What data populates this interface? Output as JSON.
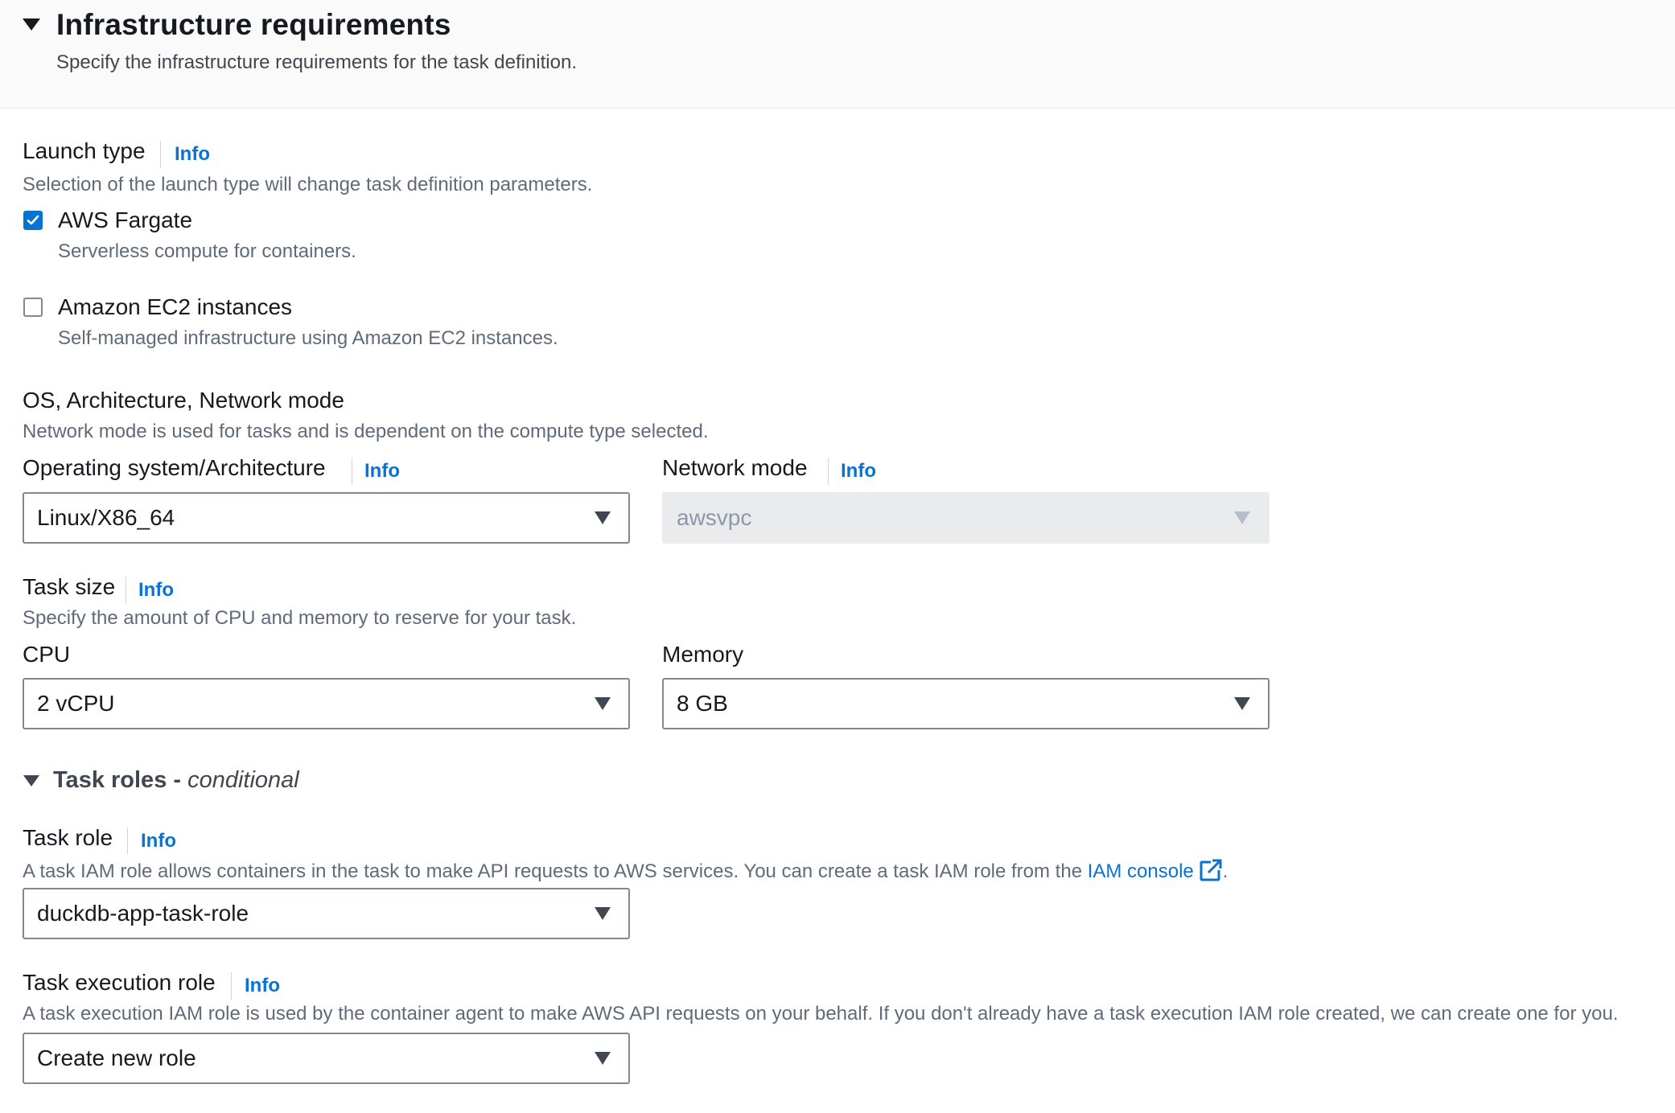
{
  "header": {
    "title": "Infrastructure requirements",
    "description": "Specify the infrastructure requirements for the task definition."
  },
  "launch_type": {
    "label": "Launch type",
    "info": "Info",
    "description": "Selection of the launch type will change task definition parameters.",
    "options": [
      {
        "label": "AWS Fargate",
        "description": "Serverless compute for containers.",
        "checked": true
      },
      {
        "label": "Amazon EC2 instances",
        "description": "Self-managed infrastructure using Amazon EC2 instances.",
        "checked": false
      }
    ]
  },
  "os_arch_network": {
    "label": "OS, Architecture, Network mode",
    "description": "Network mode is used for tasks and is dependent on the compute type selected.",
    "os_arch": {
      "label": "Operating system/Architecture",
      "info": "Info",
      "value": "Linux/X86_64"
    },
    "network_mode": {
      "label": "Network mode",
      "info": "Info",
      "value": "awsvpc",
      "disabled": true
    }
  },
  "task_size": {
    "label": "Task size",
    "info": "Info",
    "description": "Specify the amount of CPU and memory to reserve for your task.",
    "cpu": {
      "label": "CPU",
      "value": "2 vCPU"
    },
    "memory": {
      "label": "Memory",
      "value": "8 GB"
    }
  },
  "task_roles": {
    "title": "Task roles - ",
    "title_suffix": "conditional",
    "task_role": {
      "label": "Task role",
      "info": "Info",
      "description": "A task IAM role allows containers in the task to make API requests to AWS services. You can create a task IAM role from the ",
      "link_text": "IAM console",
      "description_end": ".",
      "value": "duckdb-app-task-role"
    },
    "execution_role": {
      "label": "Task execution role",
      "info": "Info",
      "description": "A task execution IAM role is used by the container agent to make AWS API requests on your behalf. If you don't already have a task execution IAM role created, we can create one for you.",
      "value": "Create new role"
    }
  },
  "colors": {
    "accent": "#0972d3",
    "text": "#16191f",
    "secondary_text": "#5f6b7a",
    "border": "#7d8998",
    "disabled_bg": "#e9ebed"
  }
}
